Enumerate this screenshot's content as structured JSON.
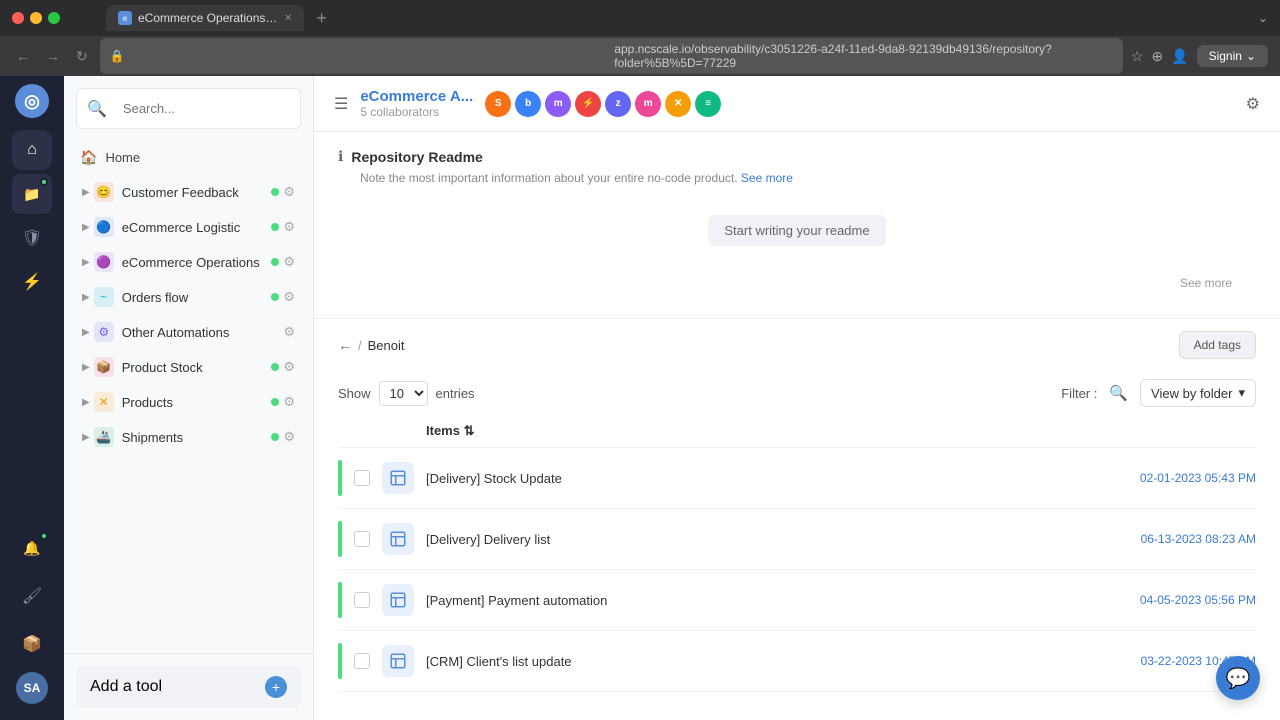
{
  "browser": {
    "url": "app.ncscale.io/observability/c3051226-a24f-11ed-9da8-92139db49136/repository?folder%5B%5D=77229",
    "tab_title": "eCommerce Operations Repo...",
    "signin_label": "Signin"
  },
  "header": {
    "menu_icon": "☰",
    "repo_title": "eCommerce A...",
    "repo_subtitle": "5 collaborators",
    "settings_icon": "⚙"
  },
  "readme": {
    "title": "Repository Readme",
    "description": "Note the most important information about your entire no-code product.",
    "see_more_link": "See more",
    "start_writing": "Start writing your readme",
    "see_more_bottom": "See more"
  },
  "breadcrumb": {
    "back": "←",
    "separator": "/",
    "current": "Benoit",
    "add_tags": "Add tags"
  },
  "table_controls": {
    "show_label": "Show",
    "entries_value": "10",
    "entries_label": "entries",
    "filter_label": "Filter :",
    "view_by_folder": "View by folder"
  },
  "items_table": {
    "header": "Items ⇅",
    "rows": [
      {
        "name": "[Delivery] Stock Update",
        "date": "02-01-2023 05:43 PM"
      },
      {
        "name": "[Delivery] Delivery list",
        "date": "06-13-2023 08:23 AM"
      },
      {
        "name": "[Payment] Payment automation",
        "date": "04-05-2023 05:56 PM"
      },
      {
        "name": "[CRM] Client's list update",
        "date": "03-22-2023 10:47 AM"
      }
    ]
  },
  "sidebar": {
    "search_placeholder": "Search...",
    "home": "Home",
    "items": [
      {
        "label": "Customer Feedback",
        "color": "#f97316",
        "has_dot": true
      },
      {
        "label": "eCommerce Logistic",
        "color": "#3b82f6",
        "has_dot": true
      },
      {
        "label": "eCommerce Operations",
        "color": "#8b5cf6",
        "has_dot": true
      },
      {
        "label": "Orders flow",
        "color": "#06b6d4",
        "has_dot": true
      },
      {
        "label": "Other Automations",
        "color": "#6366f1",
        "has_dot": false
      },
      {
        "label": "Product Stock",
        "color": "#ec4899",
        "has_dot": true
      },
      {
        "label": "Products",
        "color": "#f59e0b",
        "has_dot": true
      },
      {
        "label": "Shipments",
        "color": "#10b981",
        "has_dot": true
      }
    ],
    "add_tool": "Add a tool"
  },
  "icon_bar": {
    "avatar_initials": "SA"
  },
  "colors": {
    "green_dot": "#4ade80",
    "blue_accent": "#3a7bd5",
    "sidebar_bg": "#f8f9fa",
    "icon_bar_bg": "#1e2235"
  }
}
